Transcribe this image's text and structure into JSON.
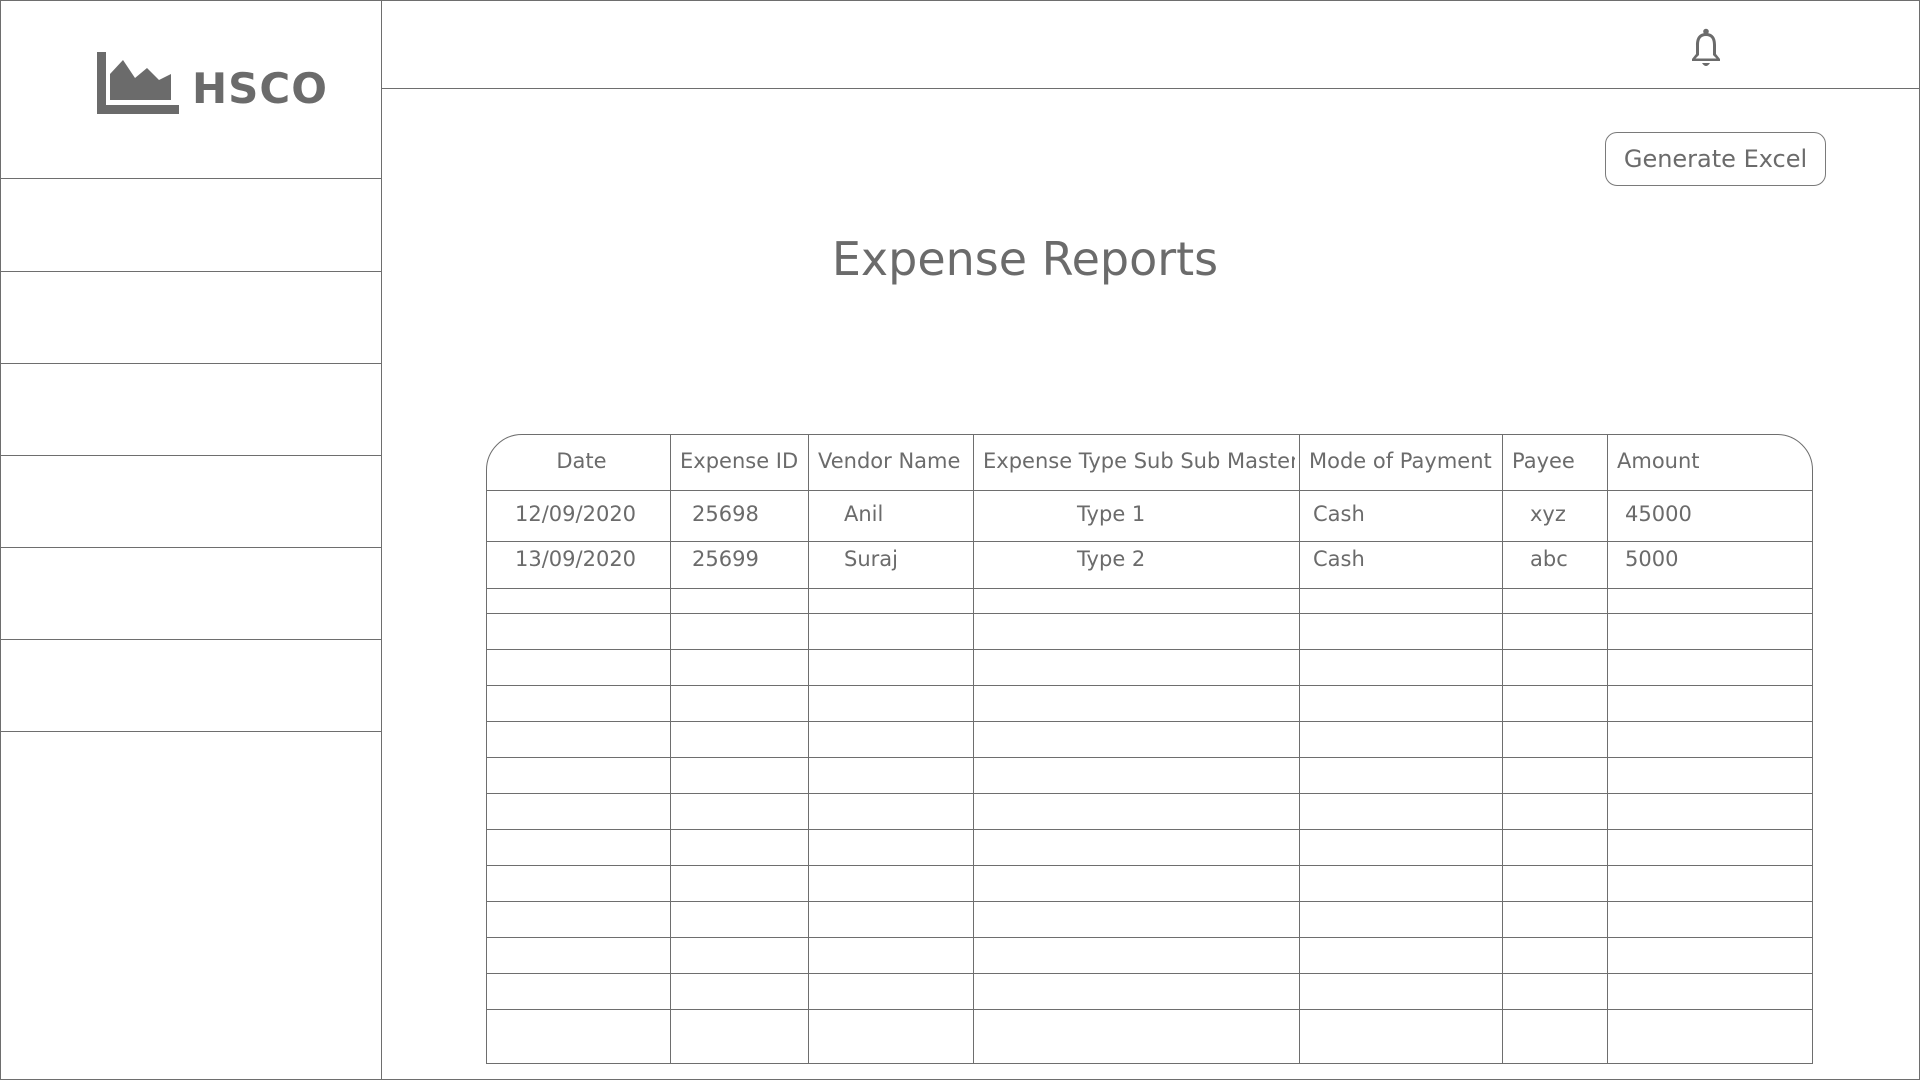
{
  "brand": {
    "name": "HSCO",
    "icon": "area-chart-icon"
  },
  "sidebar": {
    "items": [
      "",
      "",
      "",
      "",
      "",
      ""
    ]
  },
  "topbar": {
    "notification_icon": "bell-icon"
  },
  "actions": {
    "generate_excel": "Generate Excel"
  },
  "page": {
    "title": "Expense Reports"
  },
  "table": {
    "columns": [
      "Date",
      "Expense ID",
      "Vendor Name",
      "Expense Type Sub Sub Master",
      "Mode of Payment",
      "Payee",
      "Amount"
    ],
    "rows": [
      [
        "12/09/2020",
        "25698",
        "Anil",
        "Type 1",
        "Cash",
        "xyz",
        "45000"
      ],
      [
        "13/09/2020",
        "25699",
        "Suraj",
        "Type 2",
        "Cash",
        "abc",
        "5000"
      ]
    ],
    "empty_rows": 13
  },
  "colors": {
    "line": "#6e6e6e",
    "text": "#6b6b6b",
    "background": "#ffffff"
  }
}
